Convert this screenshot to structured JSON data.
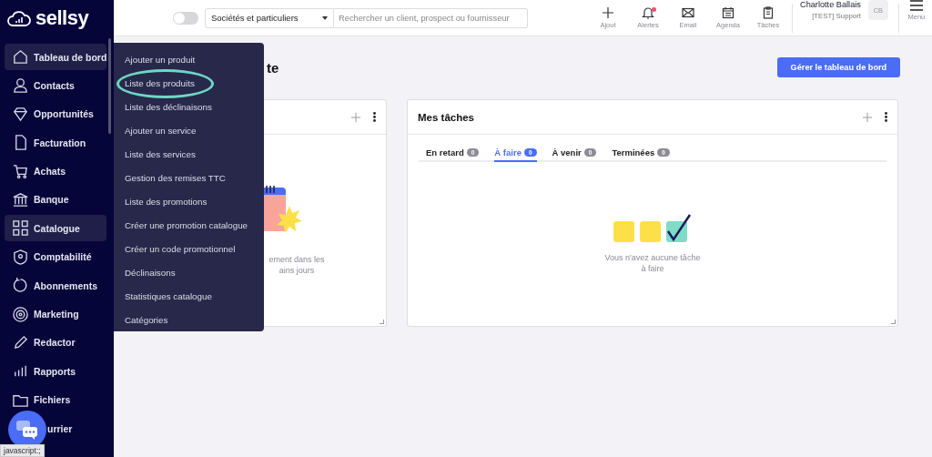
{
  "logo": {
    "text": "sellsy"
  },
  "topbar": {
    "toggle": {
      "on": false
    },
    "scope_select": {
      "value": "Sociétés et particuliers"
    },
    "search": {
      "placeholder": "Rechercher un client, prospect ou fournisseur"
    },
    "actions": [
      {
        "kind": "plus",
        "label": "Ajout",
        "badge": false
      },
      {
        "kind": "bell",
        "label": "Alertes",
        "badge": true
      },
      {
        "kind": "mail",
        "label": "Email",
        "badge": false
      },
      {
        "kind": "calendar",
        "label": "Agenda",
        "badge": false
      },
      {
        "kind": "clipboard",
        "label": "Tâches",
        "badge": false
      }
    ],
    "user": {
      "name": "Charlotte Ballais",
      "role": "[TEST] Support",
      "initials": "CB"
    },
    "menu": {
      "label": "Menu"
    }
  },
  "sidebar": {
    "items": [
      {
        "kind": "home",
        "label": "Tableau de bord",
        "selected": true
      },
      {
        "kind": "contact",
        "label": "Contacts",
        "selected": false
      },
      {
        "kind": "diamond",
        "label": "Opportunités",
        "selected": false
      },
      {
        "kind": "file",
        "label": "Facturation",
        "selected": false
      },
      {
        "kind": "cart",
        "label": "Achats",
        "selected": false
      },
      {
        "kind": "bank",
        "label": "Banque",
        "selected": false
      },
      {
        "kind": "grid",
        "label": "Catalogue",
        "selected": true
      },
      {
        "kind": "badge",
        "label": "Comptabilité",
        "selected": false
      },
      {
        "kind": "refresh",
        "label": "Abonnements",
        "selected": false
      },
      {
        "kind": "target",
        "label": "Marketing",
        "selected": false
      },
      {
        "kind": "pencil",
        "label": "Redactor",
        "selected": false
      },
      {
        "kind": "bars",
        "label": "Rapports",
        "selected": false
      },
      {
        "kind": "folder",
        "label": "Fichiers",
        "selected": false
      },
      {
        "label": "urrier",
        "selected": false
      }
    ]
  },
  "submenu": {
    "items": [
      {
        "label": "Ajouter un produit",
        "circled": false
      },
      {
        "label": "Liste des produits",
        "circled": true
      },
      {
        "label": "Liste des déclinaisons",
        "circled": false
      },
      {
        "label": "Ajouter un service",
        "circled": false
      },
      {
        "label": "Liste des services",
        "circled": false
      },
      {
        "label": "Gestion des remises TTC",
        "circled": false
      },
      {
        "label": "Liste des promotions",
        "circled": false
      },
      {
        "label": "Créer une promotion catalogue",
        "circled": false
      },
      {
        "label": "Créer un code promotionnel",
        "circled": false
      },
      {
        "label": "Déclinaisons",
        "circled": false
      },
      {
        "label": "Statistiques catalogue",
        "circled": false
      },
      {
        "label": "Catégories",
        "circled": false
      }
    ]
  },
  "page": {
    "title": "te",
    "manage_button": "Gérer le tableau de bord"
  },
  "left_card": {
    "empty_text": [
      "ement dans les",
      "ains jours"
    ]
  },
  "tasks_card": {
    "title": "Mes tâches",
    "tabs": [
      {
        "label": "En retard",
        "count": "0",
        "selected": false
      },
      {
        "label": "À faire",
        "count": "0",
        "selected": true
      },
      {
        "label": "À venir",
        "count": "0",
        "selected": false
      },
      {
        "label": "Terminées",
        "count": "0",
        "selected": false
      }
    ],
    "empty_text": [
      "Vous n'avez aucune tâche",
      "à faire"
    ]
  },
  "status_url": "javascript:;"
}
